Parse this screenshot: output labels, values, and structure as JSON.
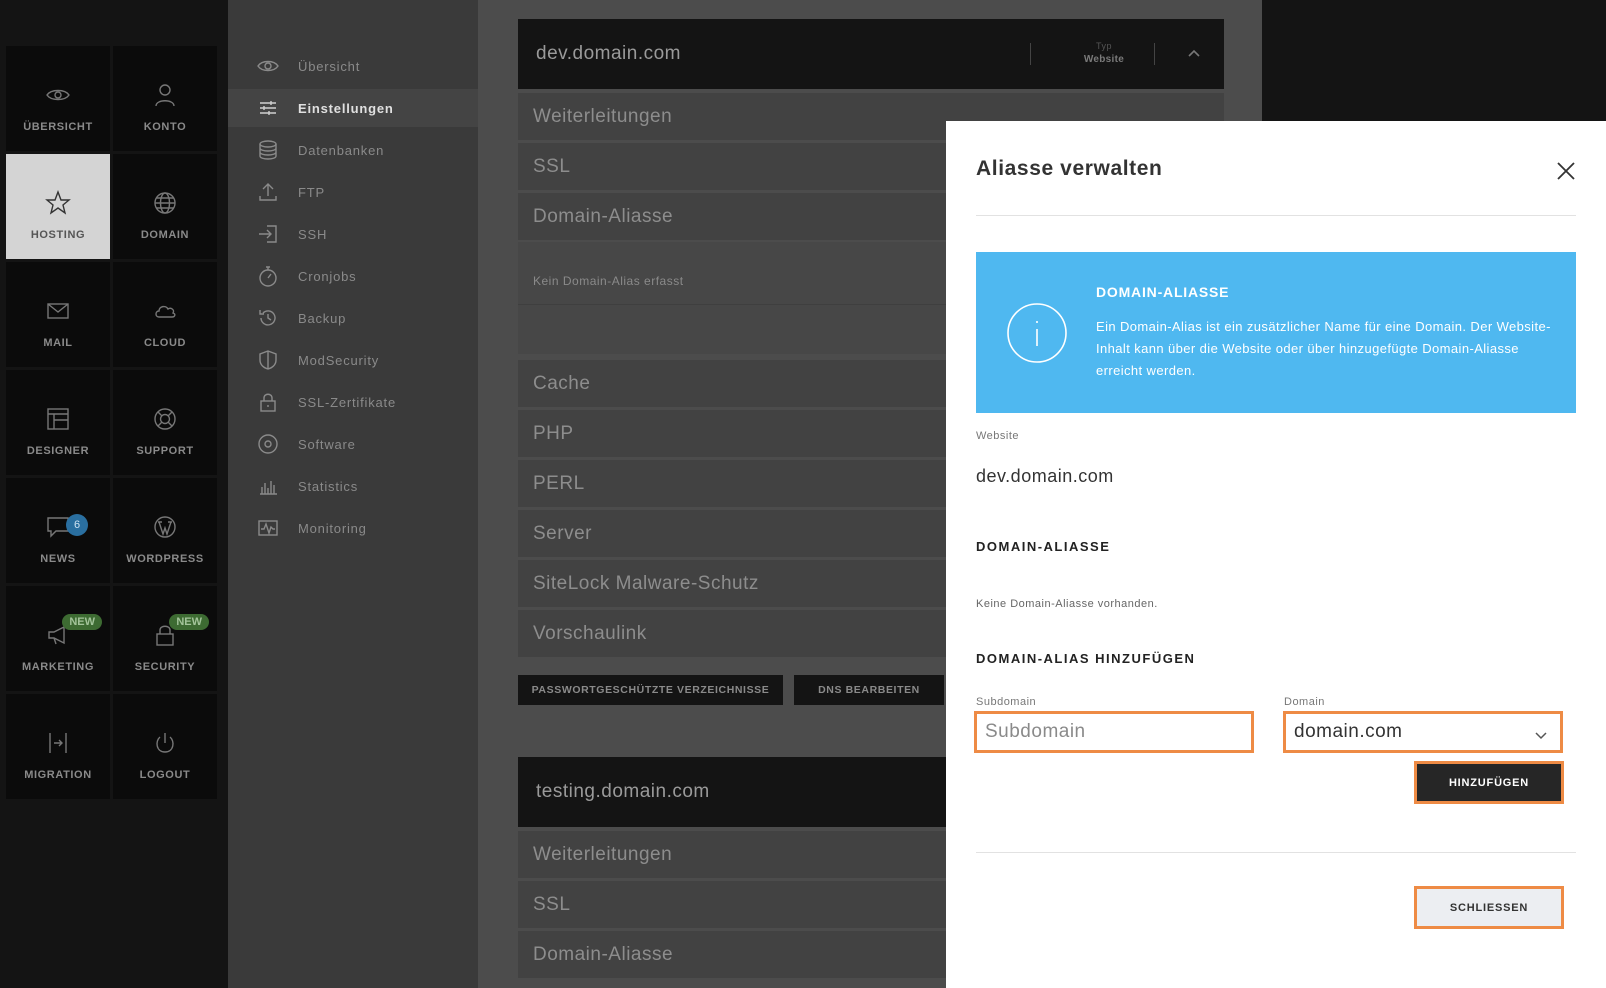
{
  "nav_tiles": [
    {
      "label": "ÜBERSICHT",
      "icon": "eye-icon"
    },
    {
      "label": "KONTO",
      "icon": "user-icon"
    },
    {
      "label": "HOSTING",
      "icon": "star-icon",
      "active": true
    },
    {
      "label": "DOMAIN",
      "icon": "globe-icon"
    },
    {
      "label": "MAIL",
      "icon": "envelope-icon"
    },
    {
      "label": "CLOUD",
      "icon": "cloud-icon"
    },
    {
      "label": "DESIGNER",
      "icon": "layout-icon"
    },
    {
      "label": "SUPPORT",
      "icon": "lifebuoy-icon"
    },
    {
      "label": "NEWS",
      "icon": "chat-icon",
      "badge": "6"
    },
    {
      "label": "WORDPRESS",
      "icon": "wordpress-icon"
    },
    {
      "label": "MARKETING",
      "icon": "megaphone-icon",
      "badge_new": "NEW"
    },
    {
      "label": "SECURITY",
      "icon": "lock-icon",
      "badge_new": "NEW"
    },
    {
      "label": "MIGRATION",
      "icon": "migration-icon"
    },
    {
      "label": "LOGOUT",
      "icon": "power-icon"
    }
  ],
  "sub_nav": [
    {
      "label": "Übersicht",
      "icon": "eye-icon"
    },
    {
      "label": "Einstellungen",
      "icon": "sliders-icon",
      "active": true
    },
    {
      "label": "Datenbanken",
      "icon": "database-icon"
    },
    {
      "label": "FTP",
      "icon": "upload-icon"
    },
    {
      "label": "SSH",
      "icon": "login-icon"
    },
    {
      "label": "Cronjobs",
      "icon": "stopwatch-icon"
    },
    {
      "label": "Backup",
      "icon": "history-icon"
    },
    {
      "label": "ModSecurity",
      "icon": "shield-icon"
    },
    {
      "label": "SSL-Zertifikate",
      "icon": "padlock-icon"
    },
    {
      "label": "Software",
      "icon": "disc-icon"
    },
    {
      "label": "Statistics",
      "icon": "bar-chart-icon"
    },
    {
      "label": "Monitoring",
      "icon": "pulse-icon"
    }
  ],
  "sites": [
    {
      "name": "dev.domain.com",
      "typ_label": "Typ",
      "typ_value": "Website",
      "rows": [
        "Weiterleitungen",
        "SSL",
        "Domain-Aliasse",
        "Cache",
        "PHP",
        "PERL",
        "Server",
        "SiteLock Malware-Schutz",
        "Vorschaulink"
      ],
      "alias_empty": "Kein Domain-Alias erfasst",
      "buttons": [
        "PASSWORTGESCHÜTZTE VERZEICHNISSE",
        "DNS BEARBEITEN"
      ]
    },
    {
      "name": "testing.domain.com",
      "rows": [
        "Weiterleitungen",
        "SSL",
        "Domain-Aliasse"
      ]
    }
  ],
  "modal": {
    "title": "Aliasse verwalten",
    "info_title": "DOMAIN-ALIASSE",
    "info_text": "Ein Domain-Alias ist ein zusätzlicher Name für eine Domain. Der Website-Inhalt kann über die Website oder über hinzugefügte Domain-Aliasse erreicht werden.",
    "website_label": "Website",
    "website_value": "dev.domain.com",
    "aliases_heading": "DOMAIN-ALIASSE",
    "aliases_empty": "Keine Domain-Aliasse vorhanden.",
    "add_heading": "DOMAIN-ALIAS HINZUFÜGEN",
    "subdomain_label": "Subdomain",
    "subdomain_placeholder": "Subdomain",
    "domain_label": "Domain",
    "domain_value": "domain.com",
    "add_button": "HINZUFÜGEN",
    "close_button": "SCHLIESSEN"
  },
  "colors": {
    "info_blue": "#4fb8f0",
    "highlight_orange": "#ee8b45",
    "active_tile": "#d4d4d4"
  }
}
